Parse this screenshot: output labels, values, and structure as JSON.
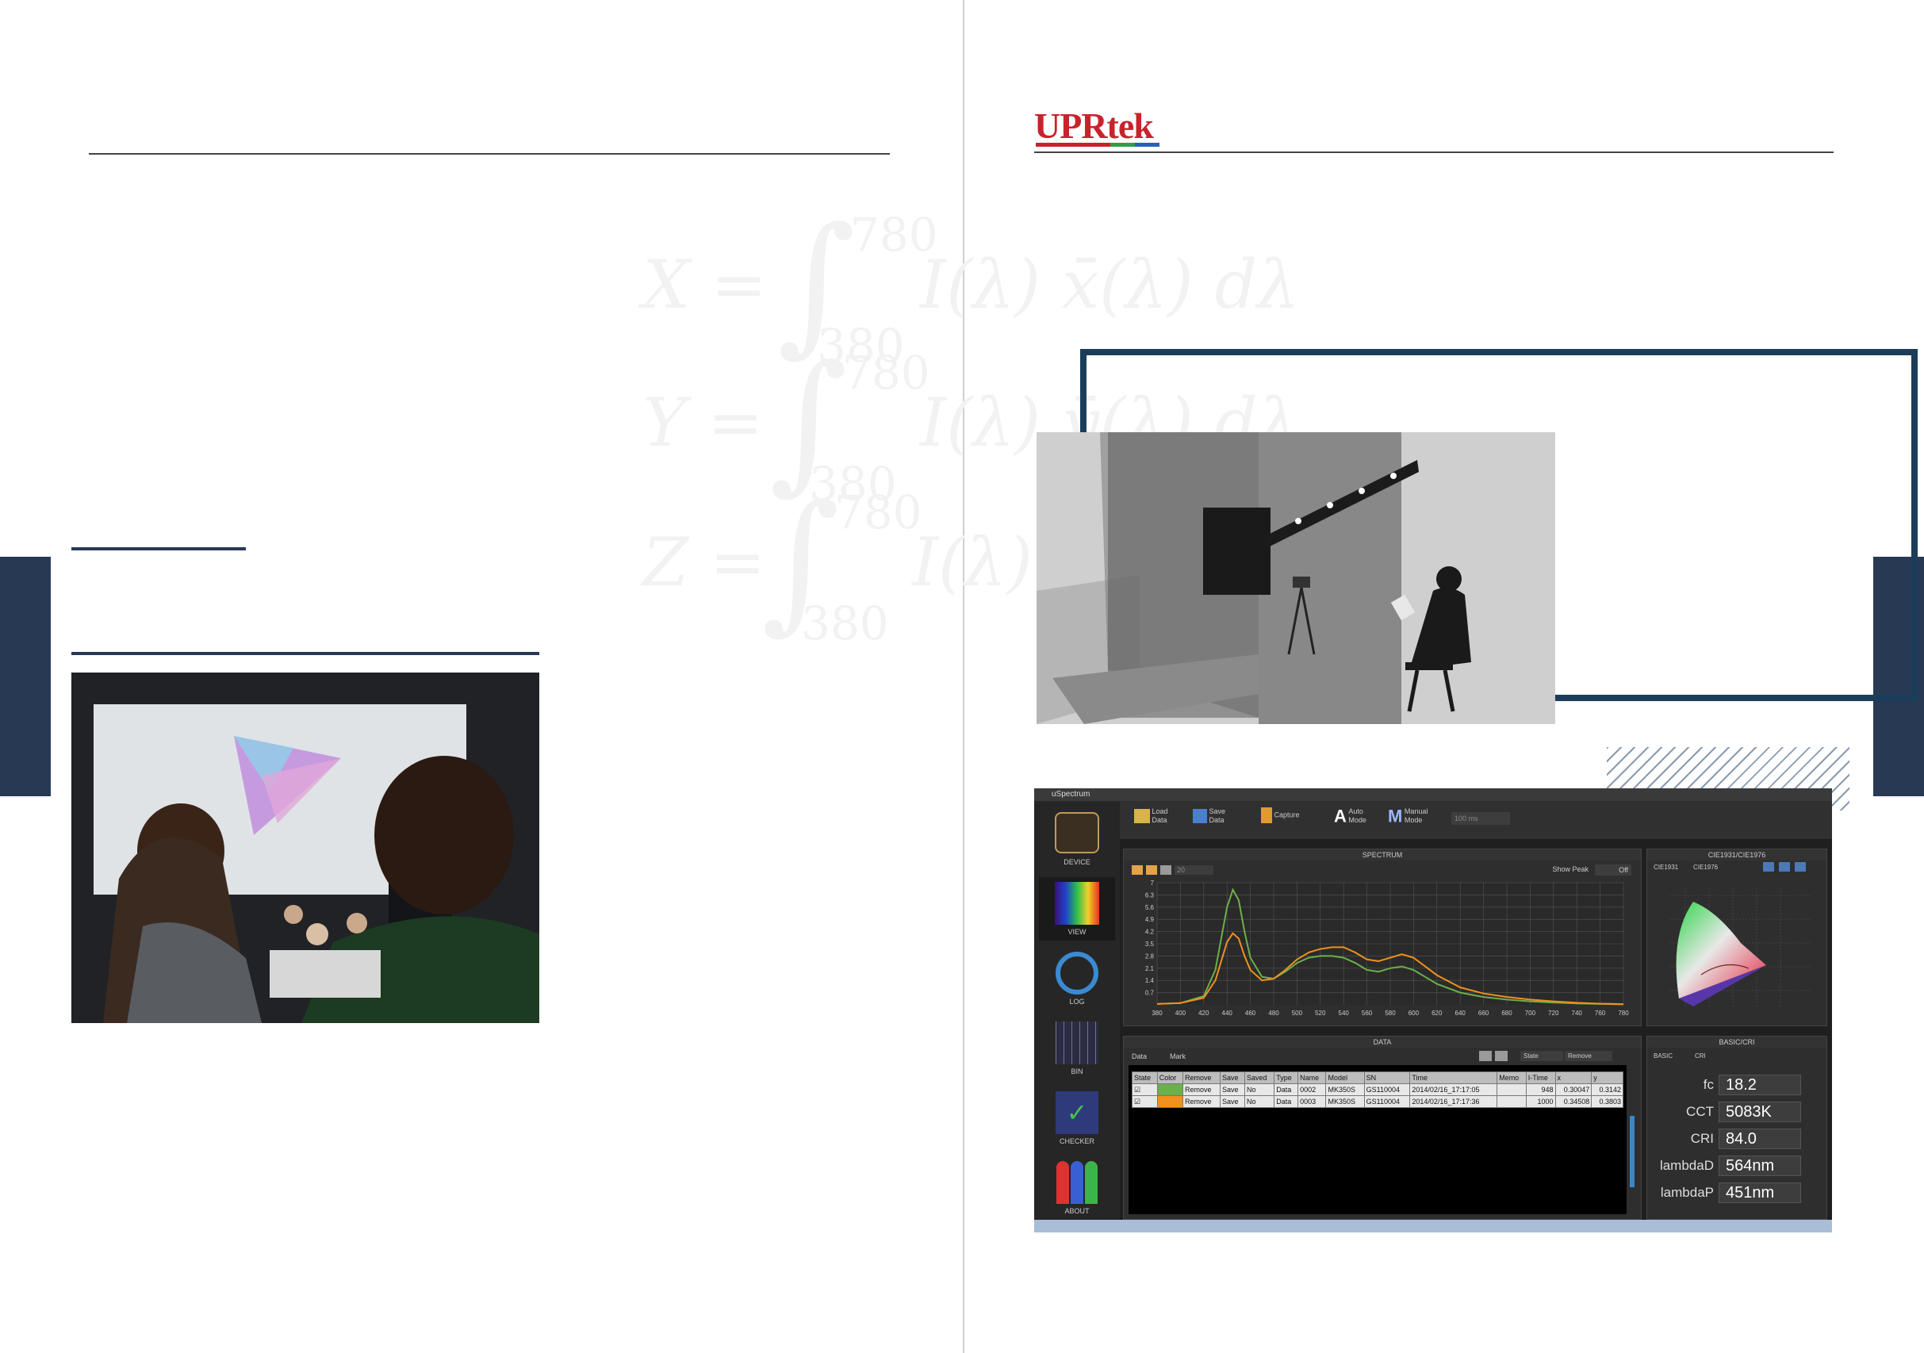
{
  "brand": {
    "logo_text": "UPRtek"
  },
  "formulas": {
    "x_lhs": "X =",
    "y_lhs": "Y =",
    "z_lhs": "Z =",
    "upper": "780",
    "lower": "380",
    "x_rhs": "I(λ) x̄(λ) dλ",
    "y_rhs": "I(λ) ȳ(λ) dλ",
    "z_rhs": "I(λ)"
  },
  "software": {
    "window_title": "uSpectrum",
    "sidebar": [
      {
        "label": "DEVICE",
        "icon": "usb-icon"
      },
      {
        "label": "VIEW",
        "icon": "spectrum-icon"
      },
      {
        "label": "LOG",
        "icon": "log-icon"
      },
      {
        "label": "BIN",
        "icon": "bin-icon"
      },
      {
        "label": "CHECKER",
        "icon": "checker-icon"
      },
      {
        "label": "ABOUT",
        "icon": "about-icon"
      }
    ],
    "toolbar": {
      "load": "Load\nData",
      "save": "Save\nData",
      "capture": "Capture",
      "auto_mode": "Auto\nMode",
      "manual_mode": "Manual\nMode",
      "ms_value": "100 ms"
    },
    "spectrum_panel": {
      "title": "SPECTRUM",
      "show_peak_label": "Show Peak",
      "show_peak_value": "Off",
      "count_value": "20"
    },
    "cie_panel": {
      "title": "CIE1931/CIE1976",
      "opt1": "CIE1931",
      "opt2": "CIE1976"
    },
    "data_panel": {
      "title": "DATA",
      "tab_data": "Data",
      "tab_mark": "Mark",
      "state_btn": "State",
      "remove_btn": "Remove",
      "columns": [
        "State",
        "Color",
        "Remove",
        "Save",
        "Saved",
        "Type",
        "Name",
        "Model",
        "SN",
        "Time",
        "Memo",
        "I-Time",
        "x",
        "y"
      ],
      "rows": [
        {
          "remove": "Remove",
          "save": "Save",
          "saved": "No",
          "type": "Data",
          "name": "0002",
          "model": "MK350S",
          "sn": "GS110004",
          "time": "2014/02/16_17:17:05",
          "memo": "",
          "itime": "948",
          "x": "0.30047",
          "y": "0.3142"
        },
        {
          "remove": "Remove",
          "save": "Save",
          "saved": "No",
          "type": "Data",
          "name": "0003",
          "model": "MK350S",
          "sn": "GS110004",
          "time": "2014/02/16_17:17:36",
          "memo": "",
          "itime": "1000",
          "x": "0.34508",
          "y": "0.3803"
        }
      ]
    },
    "basic_panel": {
      "title": "BASIC/CRI",
      "tab_basic": "BASIC",
      "tab_cri": "CRI",
      "items": [
        {
          "label": "fc",
          "value": "18.2"
        },
        {
          "label": "CCT",
          "value": "5083K"
        },
        {
          "label": "CRI",
          "value": "84.0"
        },
        {
          "label": "lambdaD",
          "value": "564nm"
        },
        {
          "label": "lambdaP",
          "value": "451nm"
        }
      ]
    },
    "colors": {
      "series_green": "#6bb04a",
      "series_orange": "#f0901e",
      "bg": "#1f1f1f"
    }
  },
  "chart_data": {
    "type": "line",
    "title": "SPECTRUM",
    "xlabel": "",
    "ylabel": "",
    "xlim": [
      380,
      780
    ],
    "ylim": [
      0,
      7
    ],
    "x_ticks": [
      380,
      400,
      420,
      440,
      460,
      480,
      500,
      520,
      540,
      560,
      580,
      600,
      620,
      640,
      660,
      680,
      700,
      720,
      740,
      760,
      780
    ],
    "y_ticks": [
      "0.7",
      "1.4",
      "2.1",
      "2.8",
      "3.5",
      "4.2",
      "4.9",
      "5.6",
      "6.3",
      "7"
    ],
    "x": [
      380,
      400,
      420,
      430,
      440,
      445,
      450,
      455,
      460,
      470,
      480,
      490,
      500,
      510,
      520,
      530,
      540,
      550,
      560,
      570,
      580,
      590,
      600,
      610,
      620,
      640,
      660,
      680,
      700,
      720,
      740,
      760,
      780
    ],
    "series": [
      {
        "color": "#6bb04a",
        "values": [
          0.05,
          0.1,
          0.5,
          2.0,
          5.6,
          6.6,
          6.0,
          4.2,
          2.7,
          1.6,
          1.5,
          1.9,
          2.4,
          2.7,
          2.8,
          2.8,
          2.7,
          2.4,
          2.0,
          1.9,
          2.1,
          2.2,
          2.0,
          1.6,
          1.2,
          0.7,
          0.45,
          0.3,
          0.2,
          0.13,
          0.08,
          0.05,
          0.03
        ]
      },
      {
        "color": "#f0901e",
        "values": [
          0.05,
          0.1,
          0.4,
          1.4,
          3.6,
          4.1,
          3.8,
          2.8,
          2.0,
          1.4,
          1.5,
          2.0,
          2.6,
          3.0,
          3.2,
          3.3,
          3.3,
          3.0,
          2.6,
          2.5,
          2.7,
          2.9,
          2.7,
          2.2,
          1.7,
          1.0,
          0.65,
          0.45,
          0.3,
          0.2,
          0.12,
          0.07,
          0.04
        ]
      }
    ],
    "grid": true
  }
}
